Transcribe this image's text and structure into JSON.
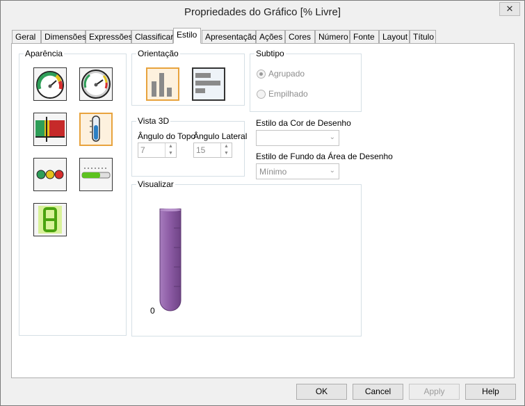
{
  "window": {
    "title": "Propriedades do Gráfico [% Livre]",
    "close_label": "✕"
  },
  "tabs": [
    {
      "label": "Geral"
    },
    {
      "label": "Dimensões"
    },
    {
      "label": "Expressões"
    },
    {
      "label": "Classificar"
    },
    {
      "label": "Estilo",
      "active": true
    },
    {
      "label": "Apresentação"
    },
    {
      "label": "Ações"
    },
    {
      "label": "Cores"
    },
    {
      "label": "Número"
    },
    {
      "label": "Fonte"
    },
    {
      "label": "Layout"
    },
    {
      "label": "Título"
    }
  ],
  "appearance": {
    "label": "Aparência",
    "icons": [
      {
        "name": "gauge-color-icon"
      },
      {
        "name": "gauge-round-icon"
      },
      {
        "name": "linear-gauge-icon"
      },
      {
        "name": "thermometer-icon",
        "selected": true
      },
      {
        "name": "traffic-light-icon"
      },
      {
        "name": "led-bar-icon"
      },
      {
        "name": "digital-display-icon"
      }
    ]
  },
  "orientation": {
    "label": "Orientação",
    "options": [
      {
        "name": "vertical-bars-icon",
        "selected": true
      },
      {
        "name": "horizontal-bars-icon"
      }
    ]
  },
  "subtype": {
    "label": "Subtipo",
    "options": [
      {
        "label": "Agrupado",
        "checked": true
      },
      {
        "label": "Empilhado",
        "checked": false
      }
    ]
  },
  "view3d": {
    "label": "Vista 3D",
    "top_angle": {
      "label": "Ângulo do Topo",
      "value": "7"
    },
    "side_angle": {
      "label": "Ângulo Lateral",
      "value": "15"
    }
  },
  "draw_color_style": {
    "label": "Estilo da Cor de Desenho",
    "value": ""
  },
  "draw_background_style": {
    "label": "Estilo de Fundo da Área de Desenho",
    "value": "Mínimo"
  },
  "preview": {
    "label": "Visualizar",
    "axis_value": "0",
    "tube_color": "#8b5aa3"
  },
  "buttons": {
    "ok": "OK",
    "cancel": "Cancel",
    "apply": "Apply",
    "help": "Help"
  }
}
